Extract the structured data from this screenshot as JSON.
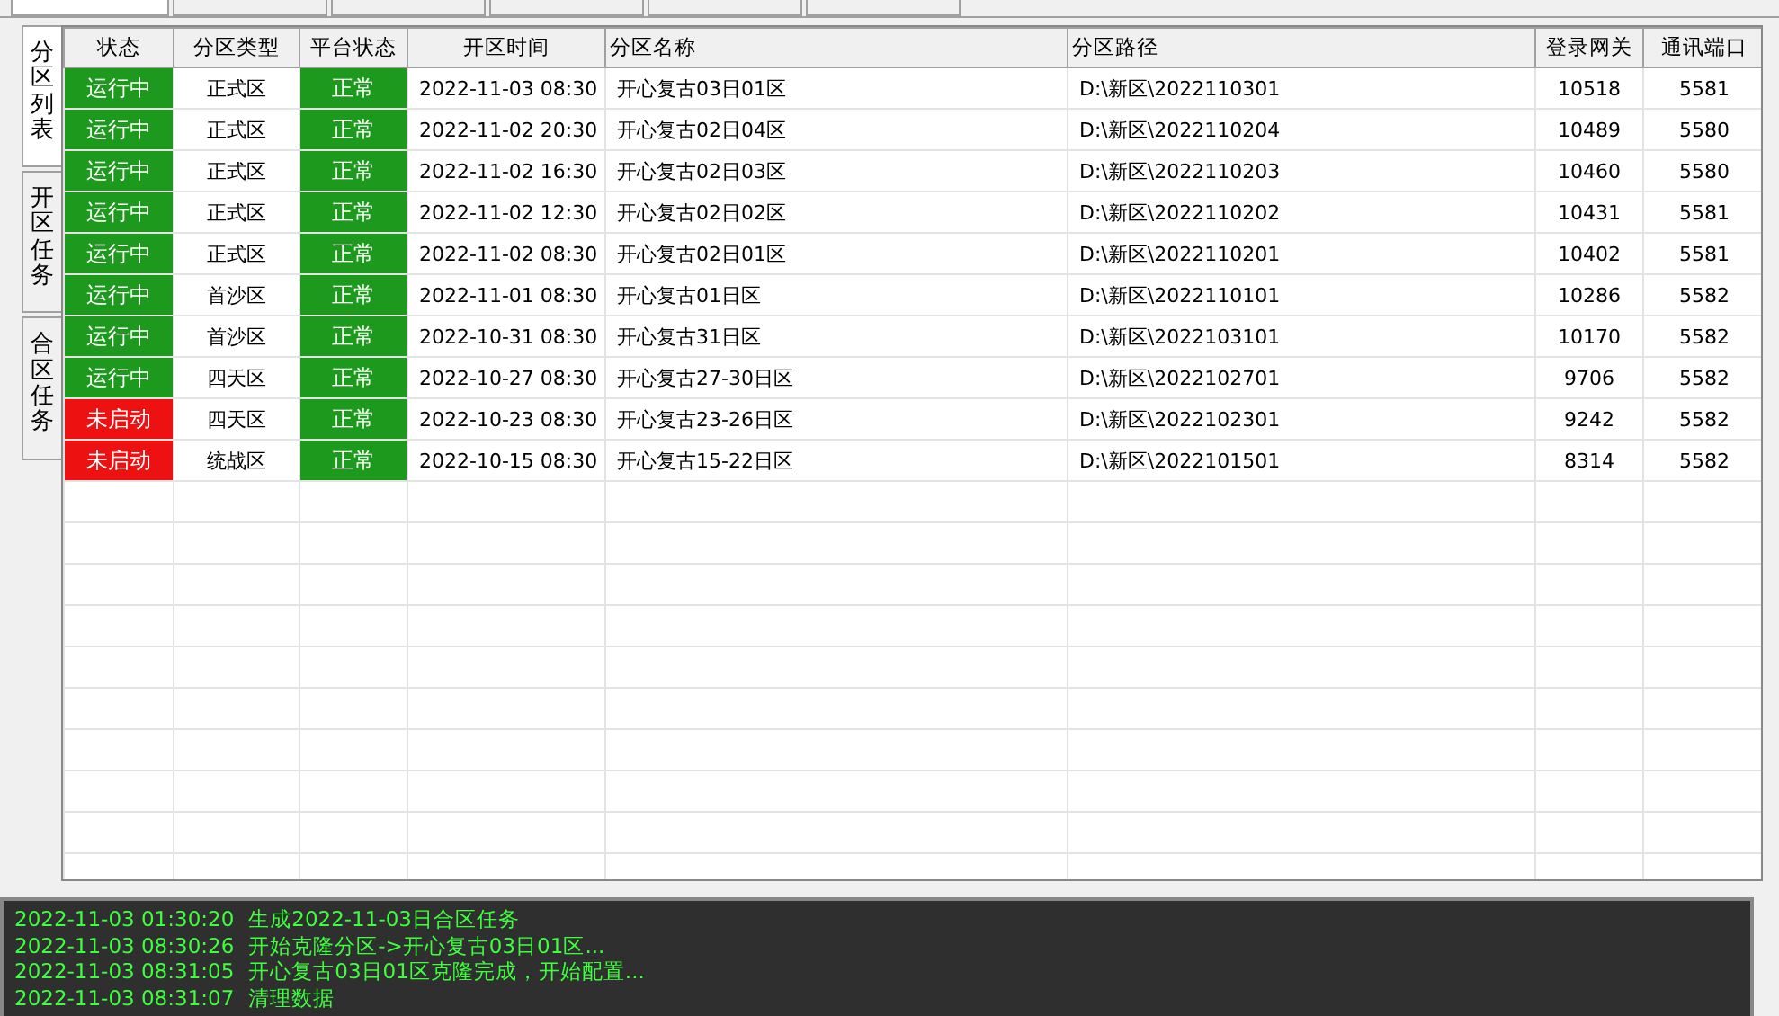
{
  "top_tabs": [
    {
      "selected": true
    },
    {
      "selected": false
    },
    {
      "selected": false
    },
    {
      "selected": false
    },
    {
      "selected": false
    },
    {
      "selected": false
    }
  ],
  "side_tabs": [
    {
      "label": "分区列表",
      "selected": true
    },
    {
      "label": "开区任务",
      "selected": false
    },
    {
      "label": "合区任务",
      "selected": false
    }
  ],
  "table": {
    "columns": [
      "状态",
      "分区类型",
      "平台状态",
      "开区时间",
      "分区名称",
      "分区路径",
      "登录网关",
      "通讯端口"
    ],
    "rows": [
      {
        "status": "运行中",
        "running": true,
        "type": "正式区",
        "platform": "正常",
        "time": "2022-11-03 08:30",
        "name": "开心复古03日01区",
        "path": "D:\\新区\\2022110301",
        "gateway": "10518",
        "port": "5581"
      },
      {
        "status": "运行中",
        "running": true,
        "type": "正式区",
        "platform": "正常",
        "time": "2022-11-02 20:30",
        "name": "开心复古02日04区",
        "path": "D:\\新区\\2022110204",
        "gateway": "10489",
        "port": "5580"
      },
      {
        "status": "运行中",
        "running": true,
        "type": "正式区",
        "platform": "正常",
        "time": "2022-11-02 16:30",
        "name": "开心复古02日03区",
        "path": "D:\\新区\\2022110203",
        "gateway": "10460",
        "port": "5580"
      },
      {
        "status": "运行中",
        "running": true,
        "type": "正式区",
        "platform": "正常",
        "time": "2022-11-02 12:30",
        "name": "开心复古02日02区",
        "path": "D:\\新区\\2022110202",
        "gateway": "10431",
        "port": "5581"
      },
      {
        "status": "运行中",
        "running": true,
        "type": "正式区",
        "platform": "正常",
        "time": "2022-11-02 08:30",
        "name": "开心复古02日01区",
        "path": "D:\\新区\\2022110201",
        "gateway": "10402",
        "port": "5581"
      },
      {
        "status": "运行中",
        "running": true,
        "type": "首沙区",
        "platform": "正常",
        "time": "2022-11-01 08:30",
        "name": "开心复古01日区",
        "path": "D:\\新区\\2022110101",
        "gateway": "10286",
        "port": "5582"
      },
      {
        "status": "运行中",
        "running": true,
        "type": "首沙区",
        "platform": "正常",
        "time": "2022-10-31 08:30",
        "name": "开心复古31日区",
        "path": "D:\\新区\\2022103101",
        "gateway": "10170",
        "port": "5582"
      },
      {
        "status": "运行中",
        "running": true,
        "type": "四天区",
        "platform": "正常",
        "time": "2022-10-27 08:30",
        "name": "开心复古27-30日区",
        "path": "D:\\新区\\2022102701",
        "gateway": "9706",
        "port": "5582"
      },
      {
        "status": "未启动",
        "running": false,
        "type": "四天区",
        "platform": "正常",
        "time": "2022-10-23 08:30",
        "name": "开心复古23-26日区",
        "path": "D:\\新区\\2022102301",
        "gateway": "9242",
        "port": "5582"
      },
      {
        "status": "未启动",
        "running": false,
        "type": "统战区",
        "platform": "正常",
        "time": "2022-10-15 08:30",
        "name": "开心复古15-22日区",
        "path": "D:\\新区\\2022101501",
        "gateway": "8314",
        "port": "5582"
      }
    ]
  },
  "log": [
    {
      "time": "2022-11-03 01:30:20",
      "message": "生成2022-11-03日合区任务"
    },
    {
      "time": "2022-11-03 08:30:26",
      "message": "开始克隆分区->开心复古03日01区..."
    },
    {
      "time": "2022-11-03 08:31:05",
      "message": "开心复古03日01区克隆完成，开始配置..."
    },
    {
      "time": "2022-11-03 08:31:07",
      "message": "清理数据"
    }
  ]
}
